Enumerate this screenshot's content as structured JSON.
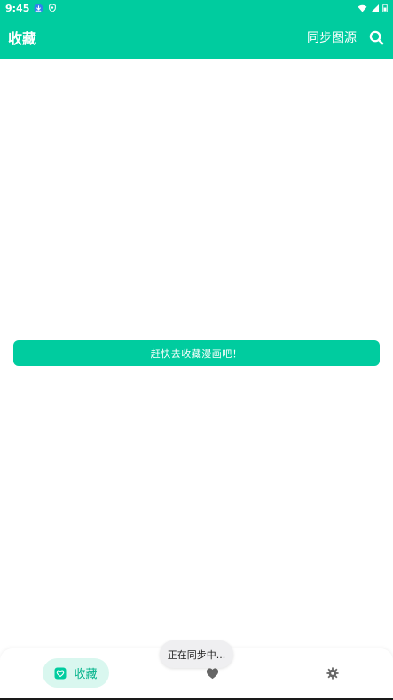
{
  "status_bar": {
    "time": "9:45"
  },
  "app_bar": {
    "title": "收藏",
    "sync_source_label": "同步图源"
  },
  "content": {
    "cta_label": "赶快去收藏漫画吧！"
  },
  "toast": {
    "text": "正在同步中..."
  },
  "bottom_nav": {
    "favorites_label": "收藏",
    "active_color": "#00cc9f",
    "active_bg": "#d9f7ef"
  },
  "colors": {
    "primary": "#00cc9f",
    "icon_gray": "#666666"
  }
}
